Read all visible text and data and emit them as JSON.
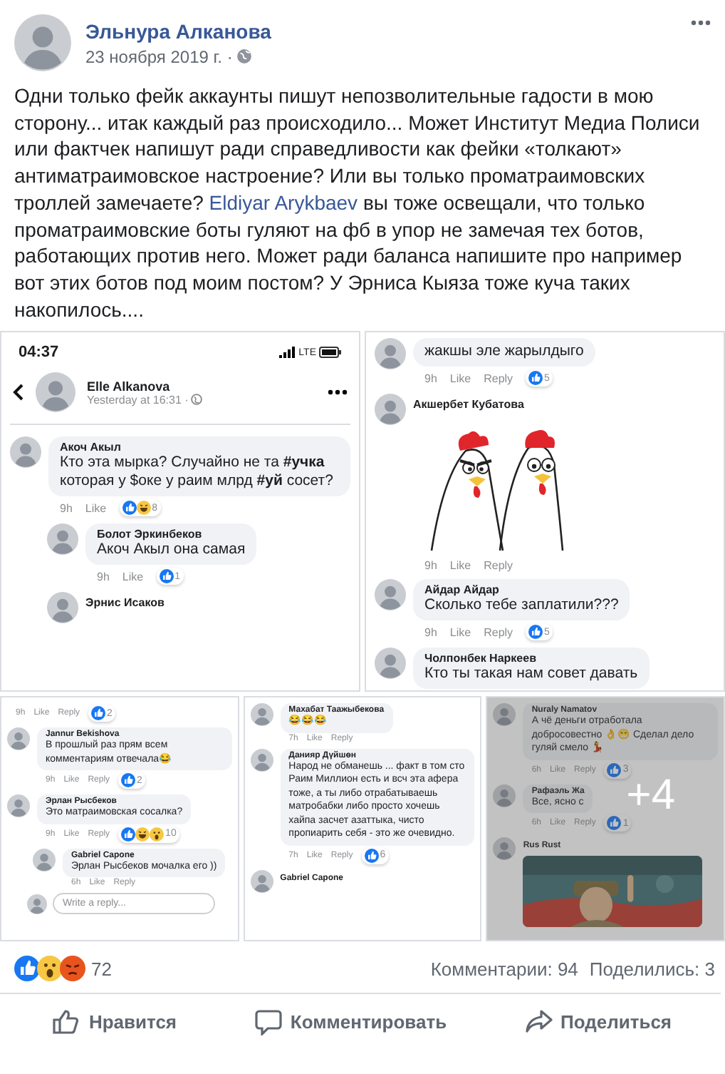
{
  "post": {
    "author": "Эльнура Алканова",
    "date": "23 ноября 2019 г. ·",
    "text": [
      {
        "kind": "plain",
        "text": "Одни только фейк аккаунты пишут непозволительные гадости в мою сторону... итак каждый раз происходило... Может Институт Медиа Полиси или фактчек напишут ради справедливости как фейки «толкают» антиматраимовское настроение? Или вы только проматраимовских троллей замечаете? "
      },
      {
        "kind": "mention",
        "text": "Eldiyar Arykbaev"
      },
      {
        "kind": "plain",
        "text": " вы тоже освещали, что только проматраимовские боты гуляют на фб в упор не замечая тех ботов, работающих против него. Может ради баланса напишите про например вот этих ботов под моим постом? У Эрниса Кыяза тоже куча таких накопилось...."
      }
    ]
  },
  "screenshots": [
    {
      "items": [
        {
          "kind": "status_bar",
          "time": "04:37",
          "network": "LTE"
        },
        {
          "kind": "post_header",
          "name": "Elle Alkanova",
          "meta": "Yesterday at 16:31 ·"
        },
        {
          "kind": "comment",
          "name": "Акоч Акыл",
          "text": "Кто эта мырка?  Случайно не та **#учка** которая у $оке у раим млрд **#уй** сосет?",
          "time": "9h",
          "actions": [
            "Like"
          ],
          "reactions": {
            "types": [
              {
                "kind": "like"
              },
              {
                "kind": "haha"
              }
            ],
            "count": "8"
          },
          "children": [
            {
              "kind": "comment",
              "name": "Болот Эркинбеков",
              "text": "Акоч Акыл она самая",
              "time": "9h",
              "actions": [
                "Like"
              ],
              "reactions": {
                "types": [
                  {
                    "kind": "like"
                  }
                ],
                "count": "1"
              }
            },
            {
              "kind": "comment",
              "name": "Эрнис Исаков"
            }
          ]
        }
      ]
    },
    {
      "items": [
        {
          "kind": "comment",
          "text": "жакшы эле жарылдыго",
          "time": "9h",
          "actions": [
            "Like",
            "Reply"
          ],
          "reactions": {
            "types": [
              {
                "kind": "like"
              }
            ],
            "count": "5"
          }
        },
        {
          "kind": "comment",
          "name": "Акшербет Кубатова",
          "attachment": {
            "kind": "sticker"
          },
          "time": "9h",
          "actions": [
            "Like",
            "Reply"
          ]
        },
        {
          "kind": "comment",
          "name": "Айдар Айдар",
          "text": "Сколько тебе заплатили???",
          "time": "9h",
          "actions": [
            "Like",
            "Reply"
          ],
          "reactions": {
            "types": [
              {
                "kind": "like"
              }
            ],
            "count": "5"
          }
        },
        {
          "kind": "comment",
          "name": "Чолпонбек Наркеев",
          "text": "Кто ты такая нам совет давать"
        }
      ]
    },
    {
      "items": [
        {
          "kind": "comment",
          "time": "9h",
          "actions": [
            "Like",
            "Reply"
          ],
          "reactions": {
            "types": [
              {
                "kind": "like"
              }
            ],
            "count": "2"
          }
        },
        {
          "kind": "comment",
          "name": "Jannur Bekishova",
          "text": "В прошлый раз прям всем комментариям отвечала😂",
          "time": "9h",
          "actions": [
            "Like",
            "Reply"
          ],
          "reactions": {
            "types": [
              {
                "kind": "like"
              }
            ],
            "count": "2"
          }
        },
        {
          "kind": "comment",
          "name": "Эрлан Рысбеков",
          "text": "Это матраимовская сосалка?",
          "time": "9h",
          "actions": [
            "Like",
            "Reply"
          ],
          "reactions": {
            "types": [
              {
                "kind": "like"
              },
              {
                "kind": "haha"
              },
              {
                "kind": "wow"
              }
            ],
            "count": "10"
          },
          "children": [
            {
              "kind": "comment",
              "name": "Gabriel Capone",
              "text": "Эрлан Рысбеков мочалка его ))",
              "time": "6h",
              "actions": [
                "Like",
                "Reply"
              ]
            }
          ]
        },
        {
          "kind": "reply_field",
          "placeholder": "Write a reply..."
        }
      ]
    },
    {
      "items": [
        {
          "kind": "comment",
          "name": "Махабат Таажыбекова",
          "text": "😂😂😂",
          "time": "7h",
          "actions": [
            "Like",
            "Reply"
          ]
        },
        {
          "kind": "comment",
          "name": "Данияр Дүйшөн",
          "text": "Народ не обманешь ... факт в том сто Раим Миллион есть и всч эта афера тоже, а ты либо отрабатываешь матробабки либо просто хочешь хайпа засчет азаттыка, чисто пропиарить себя - это же очевидно.",
          "time": "7h",
          "actions": [
            "Like",
            "Reply"
          ],
          "reactions": {
            "types": [
              {
                "kind": "like"
              }
            ],
            "count": "6"
          }
        },
        {
          "kind": "comment",
          "name": "Gabriel Capone"
        }
      ]
    },
    {
      "more": "+4",
      "items": [
        {
          "kind": "comment",
          "name": "Nuraly Namatov",
          "text": "А чё деньги отработала добросовестно 👌😁 Сделал дело гуляй смело 💃",
          "time": "6h",
          "actions": [
            "Like",
            "Reply"
          ],
          "reactions": {
            "types": [
              {
                "kind": "like"
              }
            ],
            "count": "3"
          }
        },
        {
          "kind": "comment",
          "name": "Рафаэль Жа",
          "text": "Все, ясно с",
          "time": "6h",
          "actions": [
            "Like",
            "Reply"
          ],
          "reactions": {
            "types": [
              {
                "kind": "like"
              }
            ],
            "count": "1"
          }
        },
        {
          "kind": "comment",
          "name": "Rus Rust"
        }
      ]
    }
  ],
  "summary": {
    "reactions": [
      {
        "kind": "like"
      },
      {
        "kind": "wow"
      },
      {
        "kind": "angry"
      }
    ],
    "count": "72",
    "comments": "Комментарии: 94",
    "shares": "Поделились: 3"
  },
  "actions": [
    {
      "kind": "like",
      "label": "Нравится"
    },
    {
      "kind": "comment",
      "label": "Комментировать"
    },
    {
      "kind": "share",
      "label": "Поделиться"
    }
  ]
}
